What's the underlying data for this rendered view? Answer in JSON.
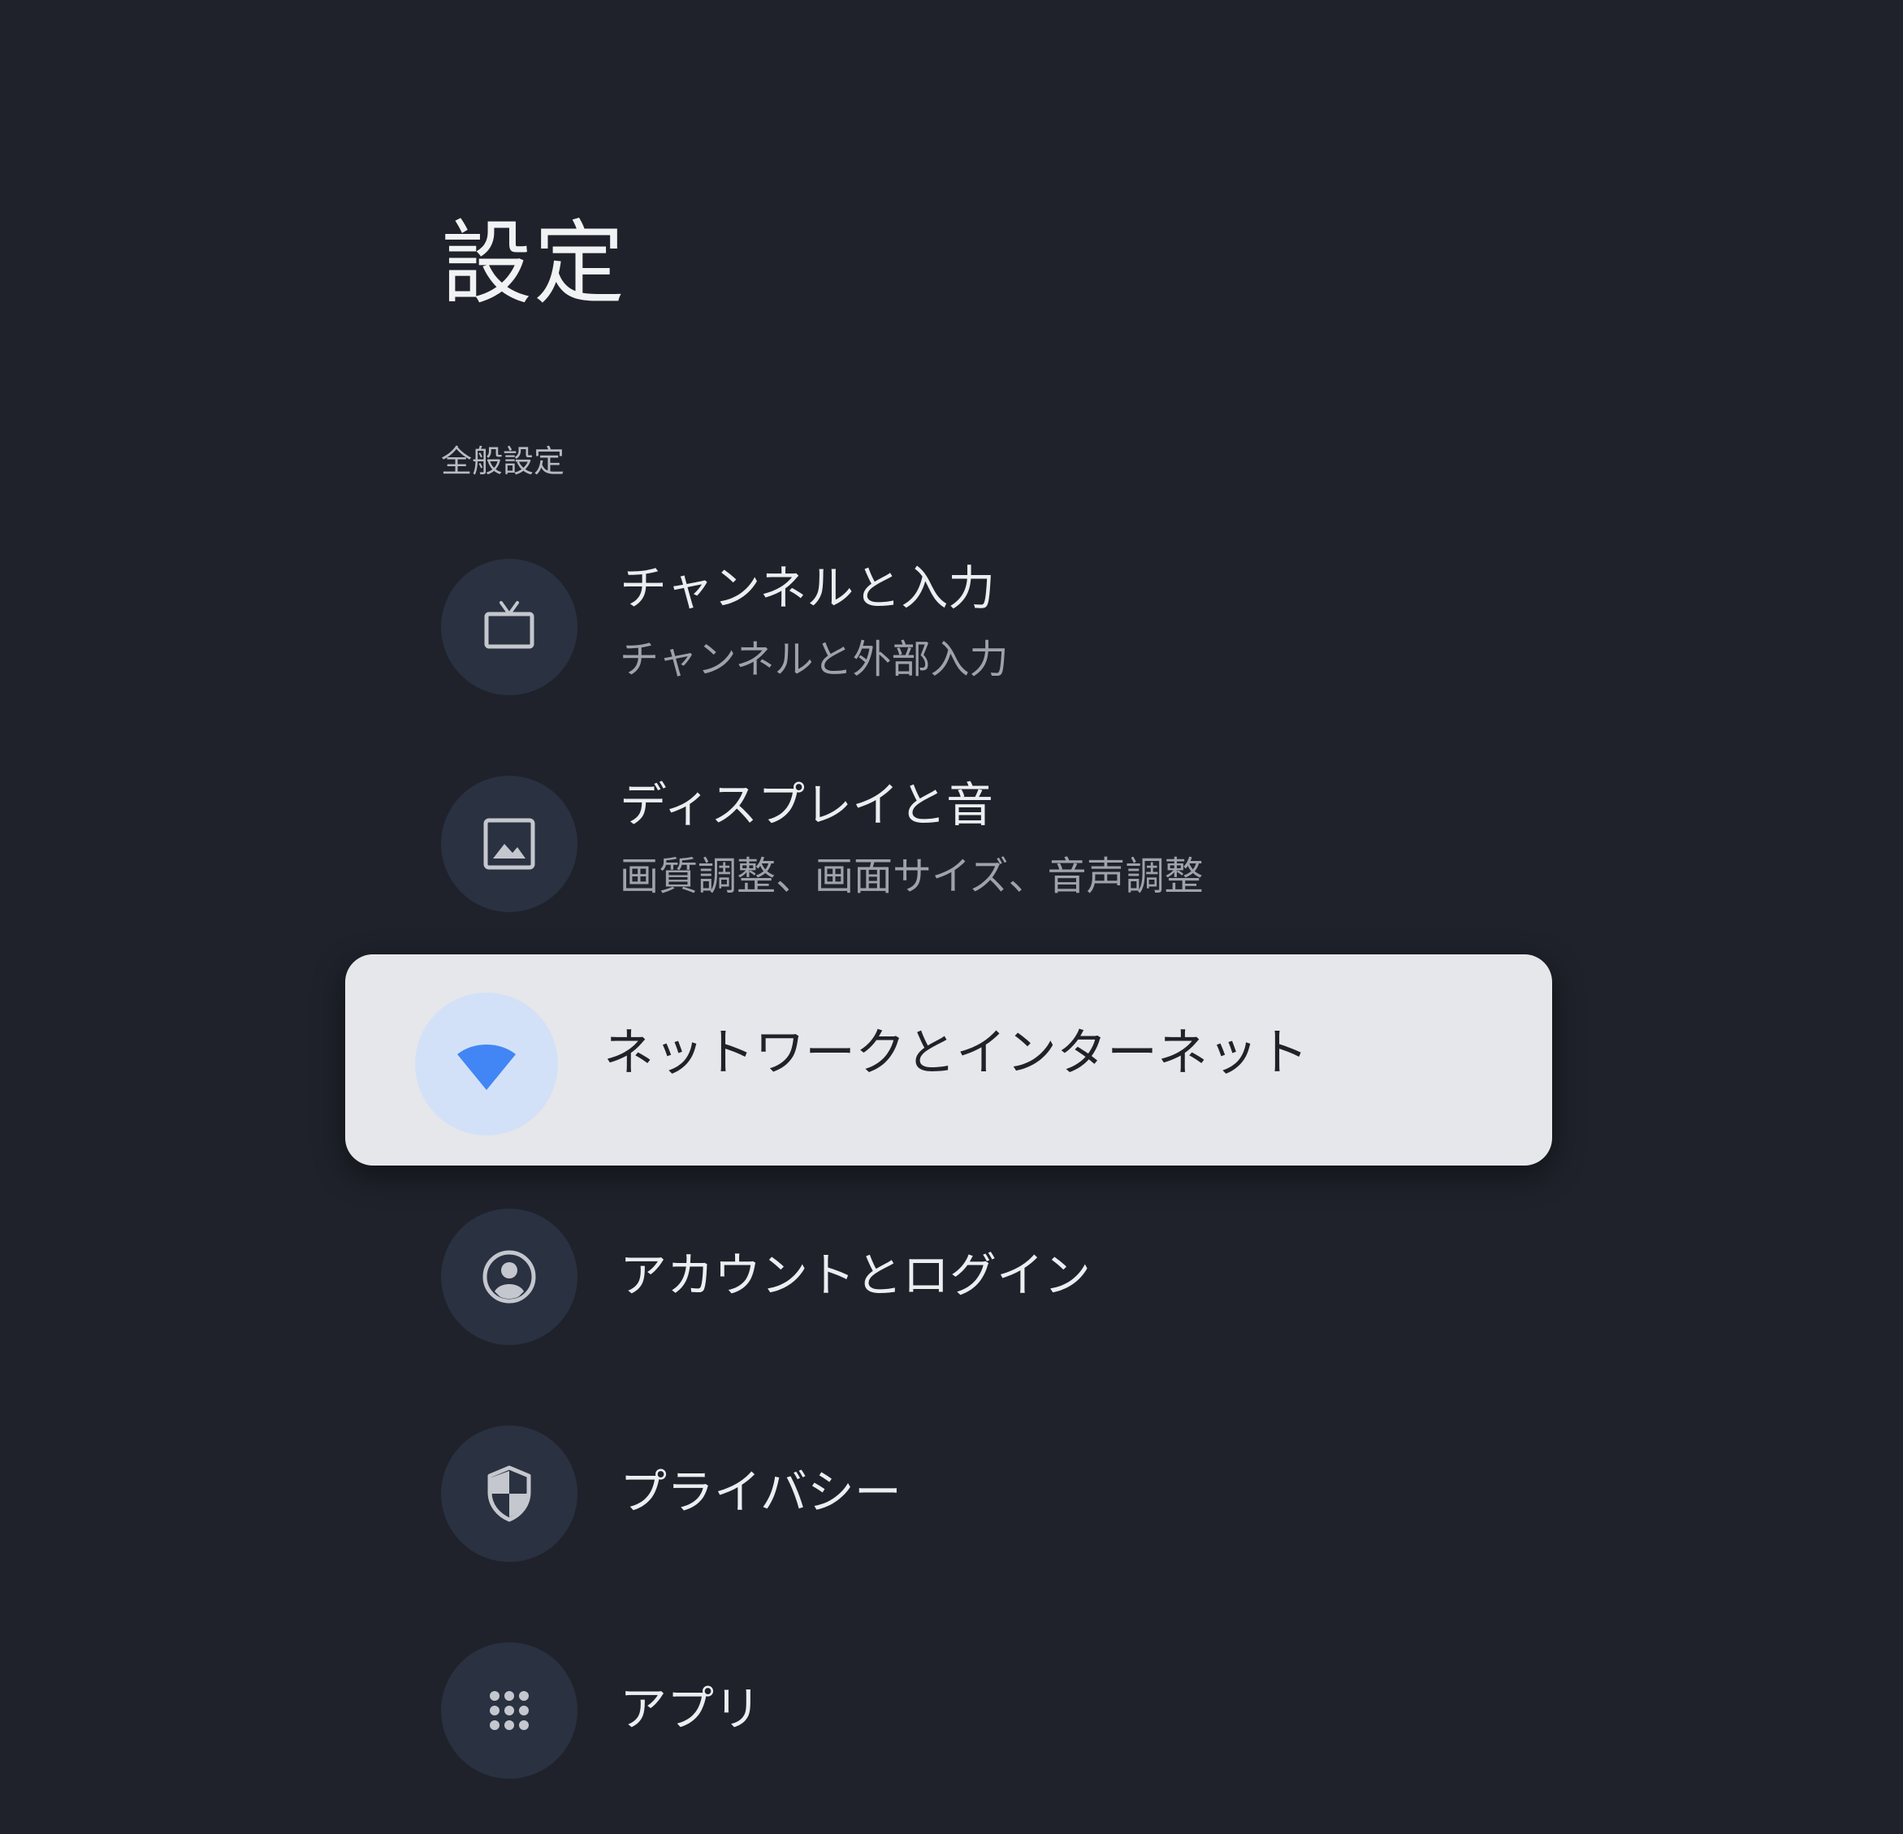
{
  "header": {
    "title": "設定"
  },
  "section": {
    "label": "全般設定"
  },
  "items": [
    {
      "id": "channels-inputs",
      "title": "チャンネルと入力",
      "subtitle": "チャンネルと外部入力",
      "icon": "tv-icon"
    },
    {
      "id": "display-sound",
      "title": "ディスプレイと音",
      "subtitle": "画質調整、画面サイズ、音声調整",
      "icon": "image-icon"
    },
    {
      "id": "network-internet",
      "title": "ネットワークとインターネット",
      "subtitle": "",
      "icon": "wifi-icon",
      "focused": true
    },
    {
      "id": "accounts-signin",
      "title": "アカウントとログイン",
      "subtitle": "",
      "icon": "account-circle-icon"
    },
    {
      "id": "privacy",
      "title": "プライバシー",
      "subtitle": "",
      "icon": "shield-icon"
    },
    {
      "id": "apps",
      "title": "アプリ",
      "subtitle": "",
      "icon": "apps-grid-icon"
    }
  ],
  "colors": {
    "background": "#1f222b",
    "icon_circle": "#2a3140",
    "focused_card": "#e6e7ea",
    "focused_icon_circle": "#d3e1f8",
    "accent_blue": "#4285f4",
    "icon_gray": "#c4c7ce"
  }
}
